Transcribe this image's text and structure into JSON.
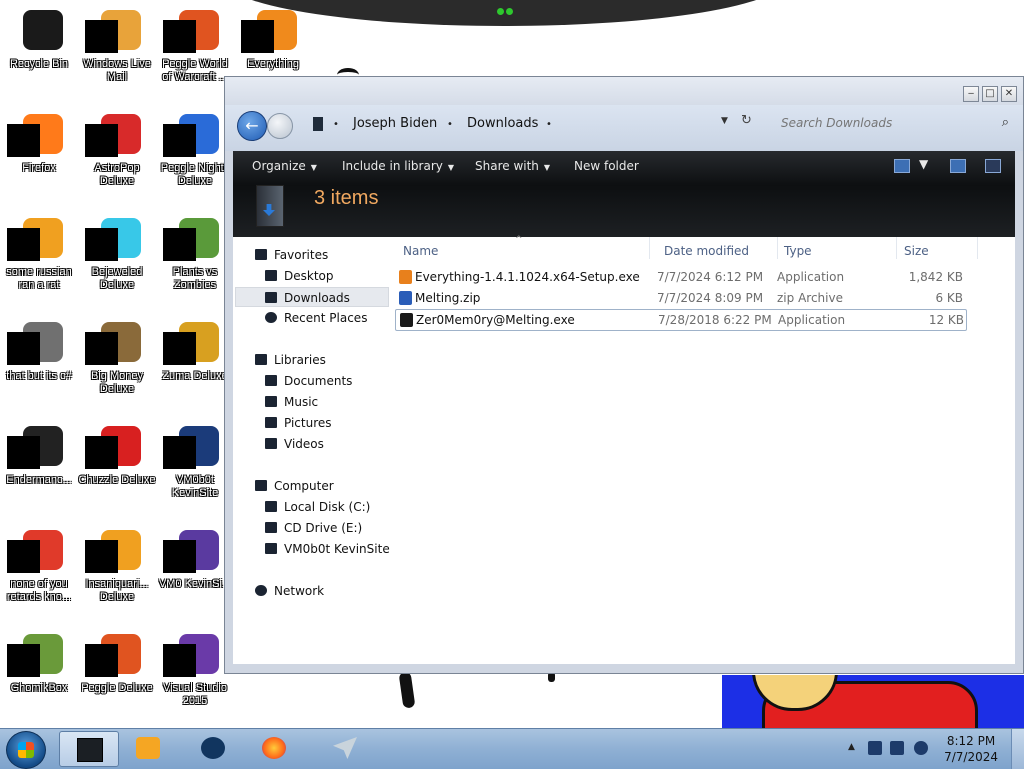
{
  "desktop": {
    "icons": [
      {
        "label": "Recycle Bin",
        "color": "#1a1a1a"
      },
      {
        "label": "Windows Live Mail",
        "color": "#e8a33a"
      },
      {
        "label": "Peggle World of Warcraft ...",
        "color": "#e05420"
      },
      {
        "label": "Everything",
        "color": "#f08a1c"
      },
      {
        "label": "Firefox",
        "color": "#ff7a1a"
      },
      {
        "label": "AstroPop Deluxe",
        "color": "#d82a2a"
      },
      {
        "label": "Peggle Nights Deluxe",
        "color": "#2a6bd8"
      },
      {
        "label": "some russian ran a rat",
        "color": "#f0a020"
      },
      {
        "label": "Bejeweled Deluxe",
        "color": "#38c8e8"
      },
      {
        "label": "Plants vs Zombies",
        "color": "#5a9a3a"
      },
      {
        "label": "that but its c#",
        "color": "#707070"
      },
      {
        "label": "Big Money Deluxe",
        "color": "#8a6a3a"
      },
      {
        "label": "Zuma Deluxe",
        "color": "#d8a020"
      },
      {
        "label": "Endermanc...",
        "color": "#222222"
      },
      {
        "label": "Chuzzle Deluxe",
        "color": "#d82020"
      },
      {
        "label": "VM0b0t KevinSite",
        "color": "#1b3b7a"
      },
      {
        "label": "none of you retards kno...",
        "color": "#e03a2a"
      },
      {
        "label": "Insaniquari... Deluxe",
        "color": "#f0a020"
      },
      {
        "label": "VM0 KevinSi...",
        "color": "#5a3aa0"
      },
      {
        "label": "GhomikBox",
        "color": "#6a9a3a"
      },
      {
        "label": "Peggle Deluxe",
        "color": "#e05420"
      },
      {
        "label": "Visual Studio 2015",
        "color": "#6a3aa8"
      }
    ]
  },
  "window": {
    "controls": {
      "minimize": "‒",
      "maximize": "□",
      "close": "✕"
    },
    "back_icon": "←",
    "address": {
      "crumbs": [
        "Joseph Biden",
        "Downloads"
      ],
      "separator": "•",
      "refresh_icon": "↻",
      "dropdown_icon": "▼"
    },
    "search": {
      "placeholder": "Search Downloads",
      "icon": "⌕"
    },
    "toolbar": {
      "organize": "Organize",
      "include_in_library": "Include in library",
      "share_with": "Share with",
      "new_folder": "New folder",
      "caret": "▼"
    },
    "items_count": "3 items",
    "nav": {
      "favorites": "Favorites",
      "desktop": "Desktop",
      "downloads": "Downloads",
      "recent_places": "Recent Places",
      "libraries": "Libraries",
      "documents": "Documents",
      "music": "Music",
      "pictures": "Pictures",
      "videos": "Videos",
      "computer": "Computer",
      "local_disk": "Local Disk (C:)",
      "cd_drive": "CD Drive (E:)",
      "vm0b0t": "VM0b0t KevinSite",
      "network": "Network"
    },
    "columns": {
      "name": "Name",
      "date": "Date modified",
      "type": "Type",
      "size": "Size",
      "sort_icon": "^"
    },
    "files": [
      {
        "name": "Everything-1.4.1.1024.x64-Setup.exe",
        "date": "7/7/2024 6:12 PM",
        "type": "Application",
        "size": "1,842 KB",
        "icon_color": "#e8801c"
      },
      {
        "name": "Melting.zip",
        "date": "7/7/2024 8:09 PM",
        "type": "zip Archive",
        "size": "6 KB",
        "icon_color": "#2a5db8"
      },
      {
        "name": "Zer0Mem0ry@Melting.exe",
        "date": "7/28/2018 6:22 PM",
        "type": "Application",
        "size": "12 KB",
        "icon_color": "#1a1a1a"
      }
    ]
  },
  "taskbar": {
    "clock_time": "8:12 PM",
    "clock_date": "7/7/2024",
    "tray_up_icon": "▲"
  }
}
